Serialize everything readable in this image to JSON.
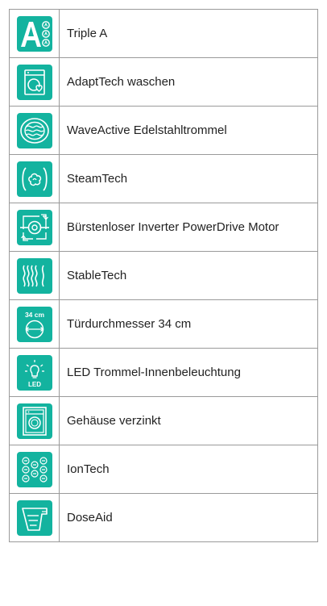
{
  "accent_color": "#13b39f",
  "features": [
    {
      "icon": "triple-a-icon",
      "label": "Triple A"
    },
    {
      "icon": "adapttech-washing-icon",
      "label": "AdaptTech waschen"
    },
    {
      "icon": "waveactive-drum-icon",
      "label": "WaveActive Edelstahltrommel"
    },
    {
      "icon": "steamtech-icon",
      "label": "SteamTech"
    },
    {
      "icon": "inverter-motor-icon",
      "label": "Bürstenloser Inverter PowerDrive Motor"
    },
    {
      "icon": "stabletech-icon",
      "label": "StableTech"
    },
    {
      "icon": "door-diameter-icon",
      "label": "Türdurchmesser 34 cm",
      "icon_text": "34 cm"
    },
    {
      "icon": "led-drum-light-icon",
      "label": "LED Trommel-Innenbeleuchtung",
      "icon_text": "LED"
    },
    {
      "icon": "galvanized-housing-icon",
      "label": "Gehäuse verzinkt"
    },
    {
      "icon": "iontech-icon",
      "label": "IonTech"
    },
    {
      "icon": "doseaid-icon",
      "label": "DoseAid"
    }
  ]
}
